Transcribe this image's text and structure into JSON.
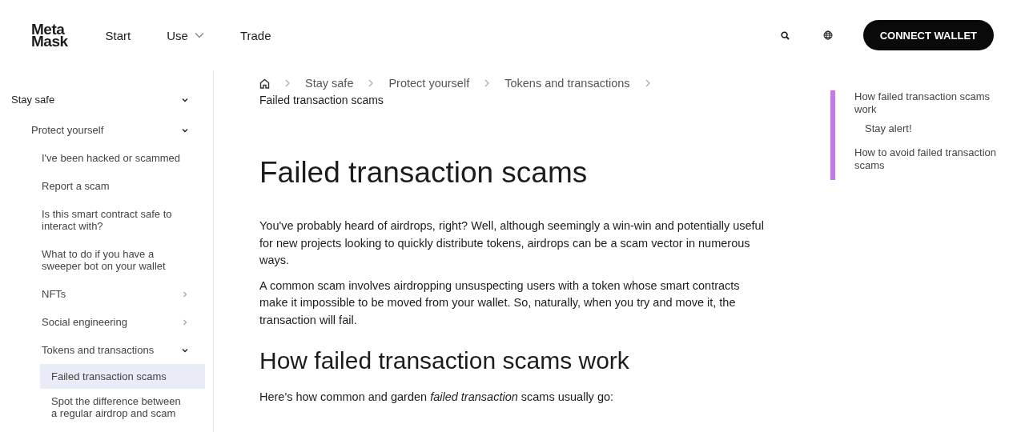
{
  "header": {
    "logo": [
      "Meta",
      "Mask"
    ],
    "nav": [
      {
        "label": "Start",
        "dropdown": false
      },
      {
        "label": "Use",
        "dropdown": true
      },
      {
        "label": "Trade",
        "dropdown": false
      }
    ],
    "cta": "CONNECT WALLET"
  },
  "sidebar": {
    "items": [
      {
        "label": "Stay safe",
        "selected": false,
        "expanded": true,
        "children": [
          {
            "label": "Protect yourself",
            "selected": false,
            "expanded": true,
            "children": [
              {
                "label": "I've been hacked or scammed",
                "selected": false
              },
              {
                "label": "Report a scam",
                "selected": false
              },
              {
                "label": "Is this smart contract safe to interact with?",
                "selected": false
              },
              {
                "label": "What to do if you have a sweeper bot on your wallet",
                "selected": false
              },
              {
                "label": "NFTs",
                "selected": false,
                "expanded": false
              },
              {
                "label": "Social engineering",
                "selected": false,
                "expanded": false
              },
              {
                "label": "Tokens and transactions",
                "selected": false,
                "expanded": true,
                "children": [
                  {
                    "label": "Failed transaction scams",
                    "selected": true
                  },
                  {
                    "label": "Spot the difference between a regular airdrop and scam",
                    "selected": false
                  }
                ]
              }
            ]
          }
        ]
      }
    ]
  },
  "breadcrumb": [
    "Stay safe",
    "Protect yourself",
    "Tokens and transactions"
  ],
  "current_page": "Failed transaction scams",
  "article": [
    {
      "kind": "h1",
      "text": "Failed transaction scams"
    },
    {
      "kind": "p",
      "text": "You've probably heard of airdrops, right? Well, although seemingly a win-win and potentially useful for new projects looking to quickly distribute tokens, airdrops can be a scam vector in numerous ways."
    },
    {
      "kind": "p",
      "text": "A common scam involves airdropping unsuspecting users with a token whose smart contracts make it impossible to be moved from your wallet. So, naturally, when you try and move it, the transaction will fail."
    },
    {
      "kind": "h2",
      "text": "How failed transaction scams work"
    },
    {
      "kind": "p",
      "text": "Here's how common and garden *failed transaction* scams usually go:"
    }
  ],
  "toc": [
    {
      "label": "How failed transaction scams work",
      "children": [
        {
          "label": "Stay alert!"
        }
      ]
    },
    {
      "label": "How to avoid failed transaction scams"
    }
  ]
}
